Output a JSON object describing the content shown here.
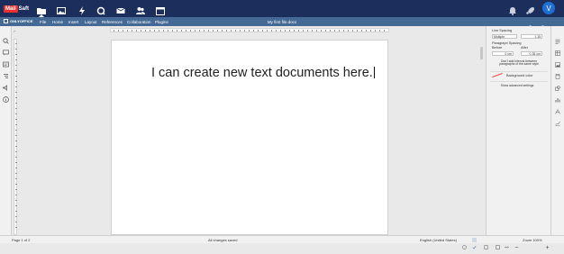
{
  "app": {
    "logo_brand": "Mail",
    "logo_suffix": "Saft",
    "user_initial": "V"
  },
  "topbar": {
    "icons": [
      "folder-icon",
      "image-icon",
      "lightning-icon",
      "search-icon",
      "mail-icon",
      "users-icon",
      "calendar-icon",
      "bell-icon",
      "rocket-icon",
      "person-icon"
    ]
  },
  "editor": {
    "product": "ONLYOFFICE",
    "menu": [
      "File",
      "Home",
      "Insert",
      "Layout",
      "References",
      "Collaboration",
      "Plugins"
    ],
    "document_title": "My first file.docx",
    "document_text": "I can create new text documents here."
  },
  "panel": {
    "line_spacing_label": "Line Spacing",
    "line_spacing_mode": "Multiple",
    "line_spacing_value": "1.15",
    "paragraph_spacing_label": "Paragraph Spacing",
    "before_label": "Before",
    "after_label": "After",
    "before_value": "0 cm",
    "after_value": "0.35 cm",
    "no_interval_label": "Don't add interval between paragraphs of the same style",
    "background_color_label": "Background color",
    "advanced_settings_label": "Show advanced settings"
  },
  "status": {
    "page_info": "Page 1 of 2",
    "save_status": "All changes saved",
    "language": "English (United States)",
    "zoom": "Zoom 100%"
  },
  "colors": {
    "topbar": "#1c2e5c",
    "menubar": "#446995",
    "accent": "#e8312f",
    "avatar": "#1f6fd1"
  }
}
